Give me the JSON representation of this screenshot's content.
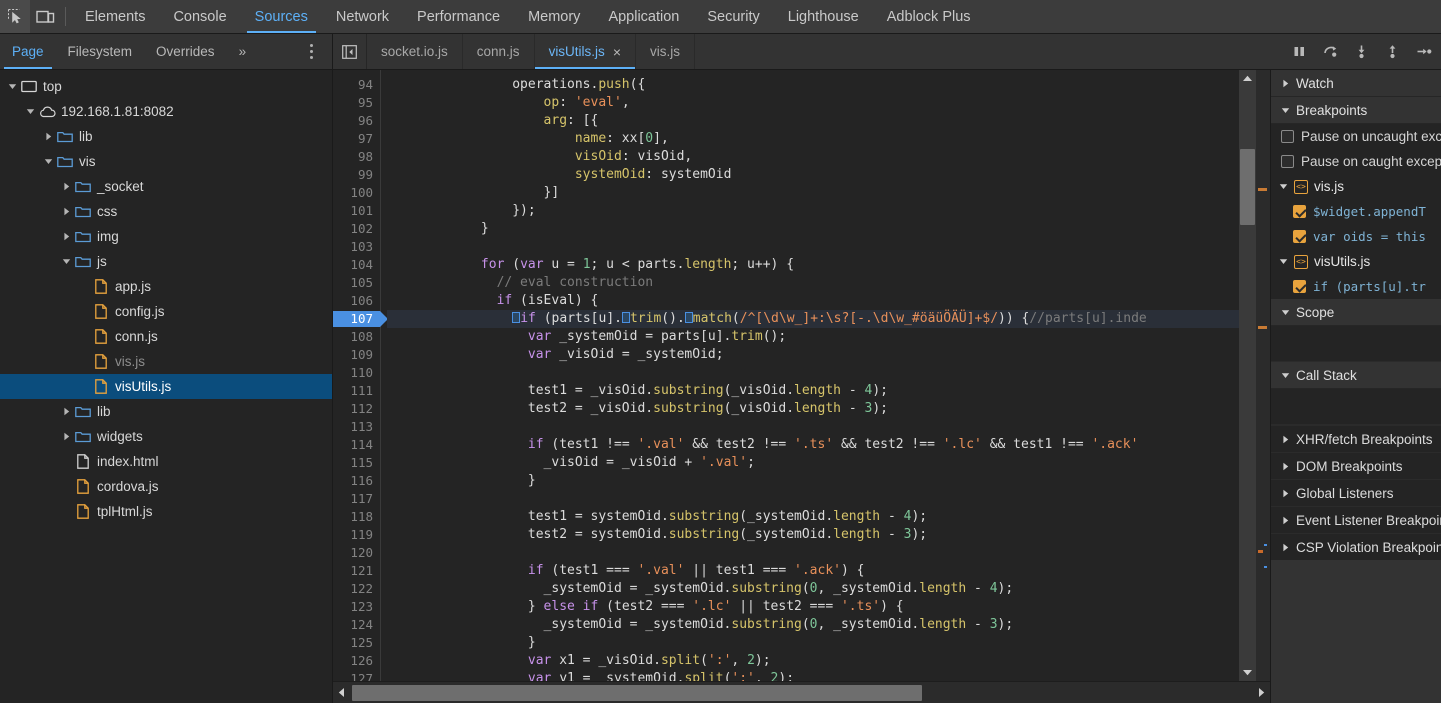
{
  "toolbar": {
    "inspect_icon": "inspect-element-icon",
    "device_icon": "device-toolbar-icon",
    "tabs": [
      {
        "label": "Elements",
        "active": false
      },
      {
        "label": "Console",
        "active": false
      },
      {
        "label": "Sources",
        "active": true
      },
      {
        "label": "Network",
        "active": false
      },
      {
        "label": "Performance",
        "active": false
      },
      {
        "label": "Memory",
        "active": false
      },
      {
        "label": "Application",
        "active": false
      },
      {
        "label": "Security",
        "active": false
      },
      {
        "label": "Lighthouse",
        "active": false
      },
      {
        "label": "Adblock Plus",
        "active": false
      }
    ]
  },
  "navigator": {
    "tabs": [
      {
        "label": "Page",
        "active": true
      },
      {
        "label": "Filesystem",
        "active": false
      },
      {
        "label": "Overrides",
        "active": false
      },
      {
        "label": "»",
        "active": false
      }
    ],
    "more_options_label": "more-options",
    "tree": [
      {
        "label": "top",
        "depth": 0,
        "icon": "frame-icon",
        "arrow": "down",
        "state": "normal"
      },
      {
        "label": "192.168.1.81:8082",
        "depth": 1,
        "icon": "cloud-icon",
        "arrow": "down",
        "state": "normal"
      },
      {
        "label": "lib",
        "depth": 2,
        "icon": "folder-icon",
        "arrow": "right",
        "state": "normal"
      },
      {
        "label": "vis",
        "depth": 2,
        "icon": "folder-icon",
        "arrow": "down",
        "state": "normal"
      },
      {
        "label": "_socket",
        "depth": 3,
        "icon": "folder-icon",
        "arrow": "right",
        "state": "normal"
      },
      {
        "label": "css",
        "depth": 3,
        "icon": "folder-icon",
        "arrow": "right",
        "state": "normal"
      },
      {
        "label": "img",
        "depth": 3,
        "icon": "folder-icon",
        "arrow": "right",
        "state": "normal"
      },
      {
        "label": "js",
        "depth": 3,
        "icon": "folder-icon",
        "arrow": "down",
        "state": "normal"
      },
      {
        "label": "app.js",
        "depth": 4,
        "icon": "js-file-icon",
        "arrow": "none",
        "state": "normal"
      },
      {
        "label": "config.js",
        "depth": 4,
        "icon": "js-file-icon",
        "arrow": "none",
        "state": "normal"
      },
      {
        "label": "conn.js",
        "depth": 4,
        "icon": "js-file-icon",
        "arrow": "none",
        "state": "normal"
      },
      {
        "label": "vis.js",
        "depth": 4,
        "icon": "js-file-icon",
        "arrow": "none",
        "state": "dimmed"
      },
      {
        "label": "visUtils.js",
        "depth": 4,
        "icon": "js-file-icon",
        "arrow": "none",
        "state": "selected"
      },
      {
        "label": "lib",
        "depth": 3,
        "icon": "folder-icon",
        "arrow": "right",
        "state": "normal"
      },
      {
        "label": "widgets",
        "depth": 3,
        "icon": "folder-icon",
        "arrow": "right",
        "state": "normal"
      },
      {
        "label": "index.html",
        "depth": 3,
        "icon": "html-file-icon",
        "arrow": "none",
        "state": "normal"
      },
      {
        "label": "cordova.js",
        "depth": 3,
        "icon": "js-file-icon",
        "arrow": "none",
        "state": "normal"
      },
      {
        "label": "tplHtml.js",
        "depth": 3,
        "icon": "js-file-icon",
        "arrow": "none",
        "state": "normal"
      }
    ]
  },
  "editor": {
    "panel_toggle_label": "show-navigator",
    "file_tabs": [
      {
        "label": "socket.io.js",
        "active": false,
        "closable": false
      },
      {
        "label": "conn.js",
        "active": false,
        "closable": false
      },
      {
        "label": "visUtils.js",
        "active": true,
        "closable": true
      },
      {
        "label": "vis.js",
        "active": false,
        "closable": false
      }
    ],
    "close_glyph": "×",
    "debug_buttons": [
      {
        "name": "pause-script-execution",
        "icon": "pause-icon"
      },
      {
        "name": "step-over-next-function-call",
        "icon": "step-over-icon"
      },
      {
        "name": "step-into-next-function-call",
        "icon": "step-into-icon"
      },
      {
        "name": "step-out-of-current-function",
        "icon": "step-out-icon"
      },
      {
        "name": "step",
        "icon": "step-icon"
      }
    ],
    "first_line": 94,
    "breakpoint_line": 107,
    "lines": [
      {
        "n": 94,
        "indent": 16,
        "tokens": [
          [
            "pl",
            "operations."
          ],
          [
            "fn",
            "push"
          ],
          [
            "pl",
            "({"
          ]
        ]
      },
      {
        "n": 95,
        "indent": 20,
        "tokens": [
          [
            "prop",
            "op"
          ],
          [
            "pl",
            ": "
          ],
          [
            "str",
            "'eval'"
          ],
          [
            "pl",
            ","
          ]
        ]
      },
      {
        "n": 96,
        "indent": 20,
        "tokens": [
          [
            "prop",
            "arg"
          ],
          [
            "pl",
            ": [{"
          ]
        ]
      },
      {
        "n": 97,
        "indent": 24,
        "tokens": [
          [
            "prop",
            "name"
          ],
          [
            "pl",
            ": xx["
          ],
          [
            "num",
            "0"
          ],
          [
            "pl",
            "],"
          ]
        ]
      },
      {
        "n": 98,
        "indent": 24,
        "tokens": [
          [
            "prop",
            "visOid"
          ],
          [
            "pl",
            ": visOid,"
          ]
        ]
      },
      {
        "n": 99,
        "indent": 24,
        "tokens": [
          [
            "prop",
            "systemOid"
          ],
          [
            "pl",
            ": systemOid"
          ]
        ]
      },
      {
        "n": 100,
        "indent": 20,
        "tokens": [
          [
            "pl",
            "}]"
          ]
        ]
      },
      {
        "n": 101,
        "indent": 16,
        "tokens": [
          [
            "pl",
            "});"
          ]
        ]
      },
      {
        "n": 102,
        "indent": 12,
        "tokens": [
          [
            "pl",
            "}"
          ]
        ]
      },
      {
        "n": 103,
        "indent": 0,
        "tokens": []
      },
      {
        "n": 104,
        "indent": 12,
        "tokens": [
          [
            "kw",
            "for"
          ],
          [
            "pl",
            " ("
          ],
          [
            "kw",
            "var"
          ],
          [
            "pl",
            " u = "
          ],
          [
            "num",
            "1"
          ],
          [
            "pl",
            "; u < parts."
          ],
          [
            "prop",
            "length"
          ],
          [
            "pl",
            "; u++) {"
          ]
        ]
      },
      {
        "n": 105,
        "indent": 14,
        "tokens": [
          [
            "cmt",
            "// eval construction"
          ]
        ]
      },
      {
        "n": 106,
        "indent": 14,
        "tokens": [
          [
            "kw",
            "if"
          ],
          [
            "pl",
            " (isEval) {"
          ]
        ]
      },
      {
        "n": 107,
        "indent": 16,
        "highlight": true,
        "tokens": [
          [
            "bpmark",
            ""
          ],
          [
            "kw",
            "if"
          ],
          [
            "pl",
            " (parts[u]."
          ],
          [
            "bpmark",
            ""
          ],
          [
            "fn",
            "trim"
          ],
          [
            "pl",
            "()."
          ],
          [
            "bpmark",
            ""
          ],
          [
            "fn",
            "match"
          ],
          [
            "pl",
            "("
          ],
          [
            "rgx",
            "/^[\\d\\w_]+:\\s?[-.\\d\\w_#öäüÖÄÜ]+$/"
          ],
          [
            "pl",
            ")) {"
          ],
          [
            "cmt",
            "//parts[u].inde"
          ]
        ]
      },
      {
        "n": 108,
        "indent": 18,
        "tokens": [
          [
            "kw",
            "var"
          ],
          [
            "pl",
            " _systemOid = parts[u]."
          ],
          [
            "fn",
            "trim"
          ],
          [
            "pl",
            "();"
          ]
        ]
      },
      {
        "n": 109,
        "indent": 18,
        "tokens": [
          [
            "kw",
            "var"
          ],
          [
            "pl",
            " _visOid = _systemOid;"
          ]
        ]
      },
      {
        "n": 110,
        "indent": 0,
        "tokens": []
      },
      {
        "n": 111,
        "indent": 18,
        "tokens": [
          [
            "pl",
            "test1 = _visOid."
          ],
          [
            "fn",
            "substring"
          ],
          [
            "pl",
            "(_visOid."
          ],
          [
            "prop",
            "length"
          ],
          [
            "pl",
            " - "
          ],
          [
            "num",
            "4"
          ],
          [
            "pl",
            ");"
          ]
        ]
      },
      {
        "n": 112,
        "indent": 18,
        "tokens": [
          [
            "pl",
            "test2 = _visOid."
          ],
          [
            "fn",
            "substring"
          ],
          [
            "pl",
            "(_visOid."
          ],
          [
            "prop",
            "length"
          ],
          [
            "pl",
            " - "
          ],
          [
            "num",
            "3"
          ],
          [
            "pl",
            ");"
          ]
        ]
      },
      {
        "n": 113,
        "indent": 0,
        "tokens": []
      },
      {
        "n": 114,
        "indent": 18,
        "tokens": [
          [
            "kw",
            "if"
          ],
          [
            "pl",
            " (test1 !== "
          ],
          [
            "str",
            "'.val'"
          ],
          [
            "pl",
            " && test2 !== "
          ],
          [
            "str",
            "'.ts'"
          ],
          [
            "pl",
            " && test2 !== "
          ],
          [
            "str",
            "'.lc'"
          ],
          [
            "pl",
            " && test1 !== "
          ],
          [
            "str",
            "'.ack'"
          ]
        ]
      },
      {
        "n": 115,
        "indent": 20,
        "tokens": [
          [
            "pl",
            "_visOid = _visOid + "
          ],
          [
            "str",
            "'.val'"
          ],
          [
            "pl",
            ";"
          ]
        ]
      },
      {
        "n": 116,
        "indent": 18,
        "tokens": [
          [
            "pl",
            "}"
          ]
        ]
      },
      {
        "n": 117,
        "indent": 0,
        "tokens": []
      },
      {
        "n": 118,
        "indent": 18,
        "tokens": [
          [
            "pl",
            "test1 = systemOid."
          ],
          [
            "fn",
            "substring"
          ],
          [
            "pl",
            "(_systemOid."
          ],
          [
            "prop",
            "length"
          ],
          [
            "pl",
            " - "
          ],
          [
            "num",
            "4"
          ],
          [
            "pl",
            ");"
          ]
        ]
      },
      {
        "n": 119,
        "indent": 18,
        "tokens": [
          [
            "pl",
            "test2 = systemOid."
          ],
          [
            "fn",
            "substring"
          ],
          [
            "pl",
            "(_systemOid."
          ],
          [
            "prop",
            "length"
          ],
          [
            "pl",
            " - "
          ],
          [
            "num",
            "3"
          ],
          [
            "pl",
            ");"
          ]
        ]
      },
      {
        "n": 120,
        "indent": 0,
        "tokens": []
      },
      {
        "n": 121,
        "indent": 18,
        "tokens": [
          [
            "kw",
            "if"
          ],
          [
            "pl",
            " (test1 === "
          ],
          [
            "str",
            "'.val'"
          ],
          [
            "pl",
            " || test1 === "
          ],
          [
            "str",
            "'.ack'"
          ],
          [
            "pl",
            ") {"
          ]
        ]
      },
      {
        "n": 122,
        "indent": 20,
        "tokens": [
          [
            "pl",
            "_systemOid = _systemOid."
          ],
          [
            "fn",
            "substring"
          ],
          [
            "pl",
            "("
          ],
          [
            "num",
            "0"
          ],
          [
            "pl",
            ", _systemOid."
          ],
          [
            "prop",
            "length"
          ],
          [
            "pl",
            " - "
          ],
          [
            "num",
            "4"
          ],
          [
            "pl",
            ");"
          ]
        ]
      },
      {
        "n": 123,
        "indent": 18,
        "tokens": [
          [
            "pl",
            "} "
          ],
          [
            "kw",
            "else if"
          ],
          [
            "pl",
            " (test2 === "
          ],
          [
            "str",
            "'.lc'"
          ],
          [
            "pl",
            " || test2 === "
          ],
          [
            "str",
            "'.ts'"
          ],
          [
            "pl",
            ") {"
          ]
        ]
      },
      {
        "n": 124,
        "indent": 20,
        "tokens": [
          [
            "pl",
            "_systemOid = _systemOid."
          ],
          [
            "fn",
            "substring"
          ],
          [
            "pl",
            "("
          ],
          [
            "num",
            "0"
          ],
          [
            "pl",
            ", _systemOid."
          ],
          [
            "prop",
            "length"
          ],
          [
            "pl",
            " - "
          ],
          [
            "num",
            "3"
          ],
          [
            "pl",
            ");"
          ]
        ]
      },
      {
        "n": 125,
        "indent": 18,
        "tokens": [
          [
            "pl",
            "}"
          ]
        ]
      },
      {
        "n": 126,
        "indent": 18,
        "tokens": [
          [
            "kw",
            "var"
          ],
          [
            "pl",
            " x1 = _visOid."
          ],
          [
            "fn",
            "split"
          ],
          [
            "pl",
            "("
          ],
          [
            "str",
            "':'"
          ],
          [
            "pl",
            ", "
          ],
          [
            "num",
            "2"
          ],
          [
            "pl",
            ");"
          ]
        ]
      },
      {
        "n": 127,
        "indent": 18,
        "tokens": [
          [
            "kw",
            "var"
          ],
          [
            "pl",
            " y1 = _systemOid."
          ],
          [
            "fn",
            "split"
          ],
          [
            "pl",
            "("
          ],
          [
            "str",
            "':'"
          ],
          [
            "pl",
            ", "
          ],
          [
            "num",
            "2"
          ],
          [
            "pl",
            ");"
          ]
        ]
      }
    ]
  },
  "debugger": {
    "sections": [
      {
        "label": "Watch",
        "expanded": false
      },
      {
        "label": "Breakpoints",
        "expanded": true
      },
      {
        "label": "Scope",
        "expanded": true
      },
      {
        "label": "Call Stack",
        "expanded": true
      },
      {
        "label": "XHR/fetch Breakpoints",
        "expanded": false
      },
      {
        "label": "DOM Breakpoints",
        "expanded": false
      },
      {
        "label": "Global Listeners",
        "expanded": false
      },
      {
        "label": "Event Listener Breakpoints",
        "expanded": false
      },
      {
        "label": "CSP Violation Breakpoints",
        "expanded": false
      }
    ],
    "pause_options": [
      {
        "label": "Pause on uncaught exceptions",
        "checked": false
      },
      {
        "label": "Pause on caught exceptions",
        "checked": false
      }
    ],
    "breakpoint_groups": [
      {
        "file": "visUtils.js",
        "file_display": "vis.js",
        "expanded": true,
        "items": [
          {
            "code": "$widget.appendT",
            "checked": true
          },
          {
            "code": "var oids = this",
            "checked": true
          }
        ]
      },
      {
        "file": "visUtils.js",
        "file_display": "visUtils.js",
        "expanded": true,
        "items": [
          {
            "code": "if (parts[u].tr",
            "checked": true
          }
        ]
      }
    ]
  },
  "colors": {
    "accent": "#5db0f7",
    "selection": "#0b4d7d",
    "breakpoint": "#4a90e2",
    "checkbox_checked": "#e8a33d",
    "js_icon": "#e8a33d",
    "folder": "#5b9bd5"
  }
}
